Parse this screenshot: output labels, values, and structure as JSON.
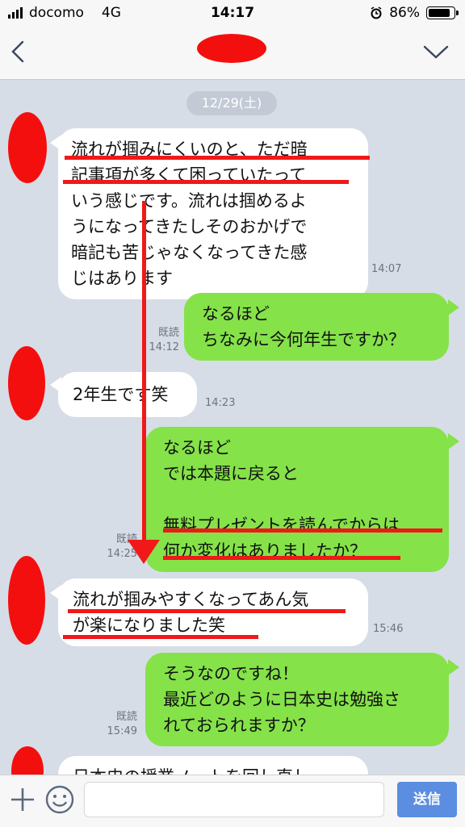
{
  "status": {
    "carrier": "docomo",
    "network": "4G",
    "time": "14:17",
    "battery": "86%",
    "battery_fraction": 0.86
  },
  "header": {
    "back_icon": "chevron-left-icon",
    "menu_icon": "chevron-down-icon"
  },
  "chat": {
    "date": "12/29(土)",
    "messages": [
      {
        "side": "in",
        "text": "流れが掴みにくいのと、ただ暗\n記事項が多くて困っていたって\nいう感じです。流れは掴めるよ\nうになってきたしそのおかげで\n暗記も苦じゃなくなってきた感\nじはあります",
        "time": "14:07"
      },
      {
        "side": "out",
        "text": "なるほど\nちなみに今何年生ですか？",
        "read": "既読",
        "time": "14:12"
      },
      {
        "side": "in",
        "text": "2年生です笑",
        "time": "14:23"
      },
      {
        "side": "out",
        "text": "なるほど\nでは本題に戻ると\n\n無料プレゼントを読んでからは\n何か変化はありましたか？",
        "read": "既読",
        "time": "14:25"
      },
      {
        "side": "in",
        "text": "流れが掴みやすくなってあん気\nが楽になりました笑",
        "time": "15:46"
      },
      {
        "side": "out",
        "text": "そうなのですね！\n最近どのように日本史は勉強さ\nれておられますか？",
        "read": "既読",
        "time": "15:49"
      },
      {
        "side": "in",
        "text": "日本史の授業ノートを回し直し"
      }
    ]
  },
  "input": {
    "plus_icon": "plus-icon",
    "sticker_icon": "smiley-icon",
    "placeholder": "",
    "send_label": "送信"
  },
  "colors": {
    "background": "#d7dde6",
    "outgoing": "#85e249",
    "incoming": "#ffffff",
    "annotation": "#f01818",
    "send": "#5b8de0"
  }
}
